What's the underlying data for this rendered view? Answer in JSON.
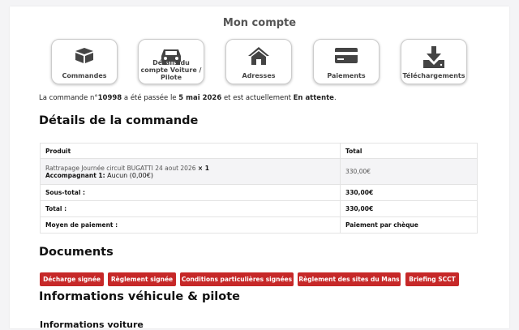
{
  "page_title": "Mon compte",
  "nav": [
    {
      "icon": "box-icon",
      "label": "Commandes"
    },
    {
      "icon": "car-icon",
      "label": "Détails du compte Voiture / Pilote"
    },
    {
      "icon": "house-icon",
      "label": "Adresses"
    },
    {
      "icon": "credit-card-icon",
      "label": "Paiements"
    },
    {
      "icon": "download-icon",
      "label": "Téléchargements"
    }
  ],
  "order": {
    "prefix": "La commande n°",
    "number": "10998",
    "mid1": " a été passée le ",
    "date": "5 mai 2026",
    "mid2": " et est actuellement ",
    "status": "En attente",
    "suffix": "."
  },
  "details_heading": "Détails de la commande",
  "table": {
    "col_product": "Produit",
    "col_total": "Total",
    "item_name": "Rattrapage Journée circuit BUGATTI 24 aout 2026 ",
    "item_qty": "× 1",
    "item_meta_label": "Accompagnant 1:",
    "item_meta_value": " Aucun (0,00€)",
    "item_total": "330,00€",
    "subtotal_label": "Sous-total :",
    "subtotal_value": "330,00€",
    "total_label": "Total :",
    "total_value": "330,00€",
    "payment_label": "Moyen de paiement :",
    "payment_value": "Paiement par chèque"
  },
  "documents_heading": "Documents",
  "documents": [
    "Décharge signée",
    "Règlement signée",
    "Conditions particulières signées",
    "Règlement des sites du Mans",
    "Briefing SCCT"
  ],
  "vehicle_heading": "Informations véhicule & pilote",
  "vehicle_sub": "Informations voiture",
  "colors": {
    "accent": "#c62828",
    "icon": "#444444"
  }
}
